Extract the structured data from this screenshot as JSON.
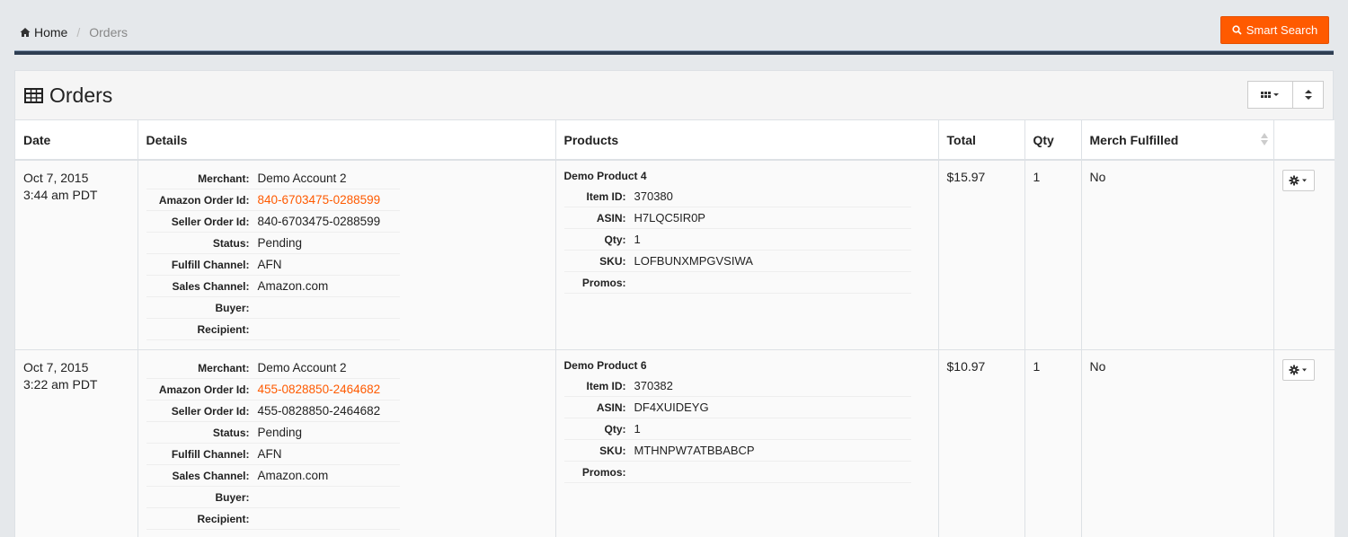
{
  "breadcrumb": {
    "home": "Home",
    "current": "Orders"
  },
  "toolbar": {
    "smart_search": "Smart Search"
  },
  "panel": {
    "title": "Orders"
  },
  "table": {
    "columns": [
      "Date",
      "Details",
      "Products",
      "Total",
      "Qty",
      "Merch Fulfilled",
      ""
    ],
    "detail_labels": {
      "merchant": "Merchant:",
      "amazon_order_id": "Amazon Order Id:",
      "seller_order_id": "Seller Order Id:",
      "status": "Status:",
      "fulfill_channel": "Fulfill Channel:",
      "sales_channel": "Sales Channel:",
      "buyer": "Buyer:",
      "recipient": "Recipient:"
    },
    "product_labels": {
      "item_id": "Item ID:",
      "asin": "ASIN:",
      "qty": "Qty:",
      "sku": "SKU:",
      "promos": "Promos:"
    },
    "rows": [
      {
        "date": "Oct 7, 2015",
        "time": "3:44 am PDT",
        "merchant": "Demo Account 2",
        "amazon_order_id": "840-6703475-0288599",
        "seller_order_id": "840-6703475-0288599",
        "status": "Pending",
        "fulfill_channel": "AFN",
        "sales_channel": "Amazon.com",
        "buyer": "",
        "recipient": "",
        "product_name": "Demo Product 4",
        "item_id": "370380",
        "asin": "H7LQC5IR0P",
        "qty_detail": "1",
        "sku": "LOFBUNXMPGVSIWA",
        "promos": "",
        "total": "$15.97",
        "qty": "1",
        "merch_fulfilled": "No"
      },
      {
        "date": "Oct 7, 2015",
        "time": "3:22 am PDT",
        "merchant": "Demo Account 2",
        "amazon_order_id": "455-0828850-2464682",
        "seller_order_id": "455-0828850-2464682",
        "status": "Pending",
        "fulfill_channel": "AFN",
        "sales_channel": "Amazon.com",
        "buyer": "",
        "recipient": "",
        "product_name": "Demo Product 6",
        "item_id": "370382",
        "asin": "DF4XUIDEYG",
        "qty_detail": "1",
        "sku": "MTHNPW7ATBBABCP",
        "promos": "",
        "total": "$10.97",
        "qty": "1",
        "merch_fulfilled": "No"
      }
    ]
  },
  "colors": {
    "accent": "#ff5a00",
    "rule": "#2e3e52"
  }
}
